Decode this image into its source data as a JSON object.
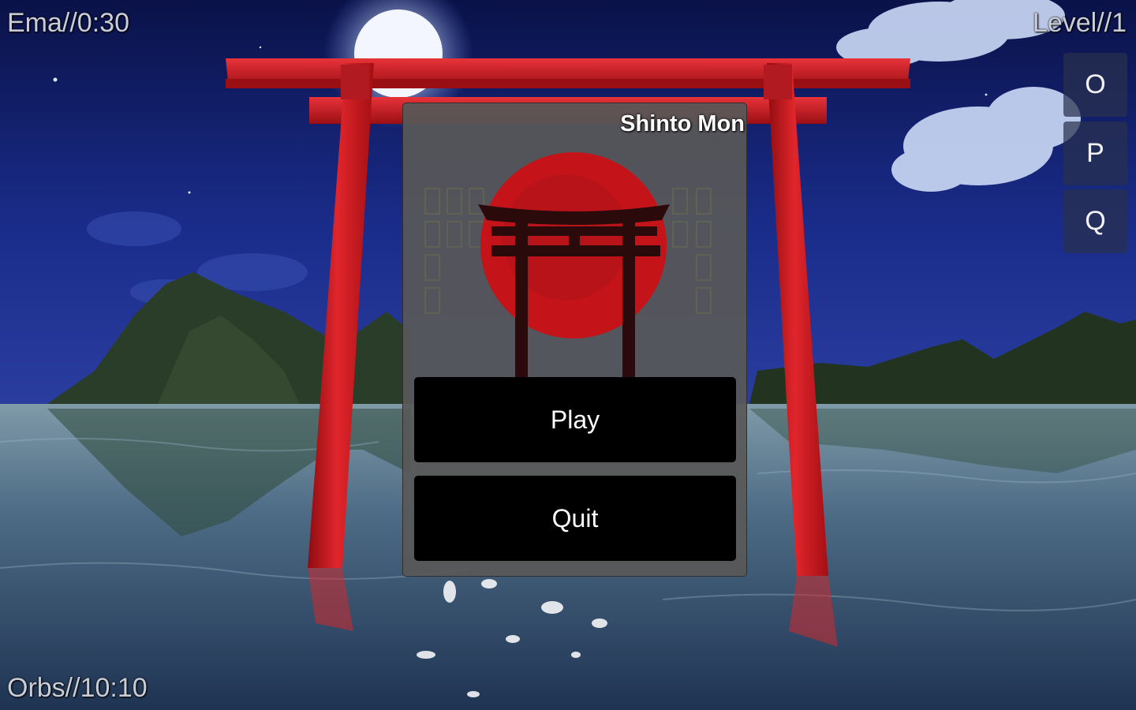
{
  "hud": {
    "ema": "Ema//0:30",
    "level": "Level//1",
    "orbs": "Orbs//10:10"
  },
  "side_buttons": [
    {
      "label": "O"
    },
    {
      "label": "P"
    },
    {
      "label": "Q"
    }
  ],
  "menu": {
    "title": "Shinto Mon",
    "play_label": "Play",
    "quit_label": "Quit"
  },
  "colors": {
    "gate_red": "#c4141a",
    "logo_sun": "#c8151b",
    "panel": "#585858",
    "button": "#000000",
    "sky": "#0e1a5c",
    "water": "#3a5c78"
  }
}
